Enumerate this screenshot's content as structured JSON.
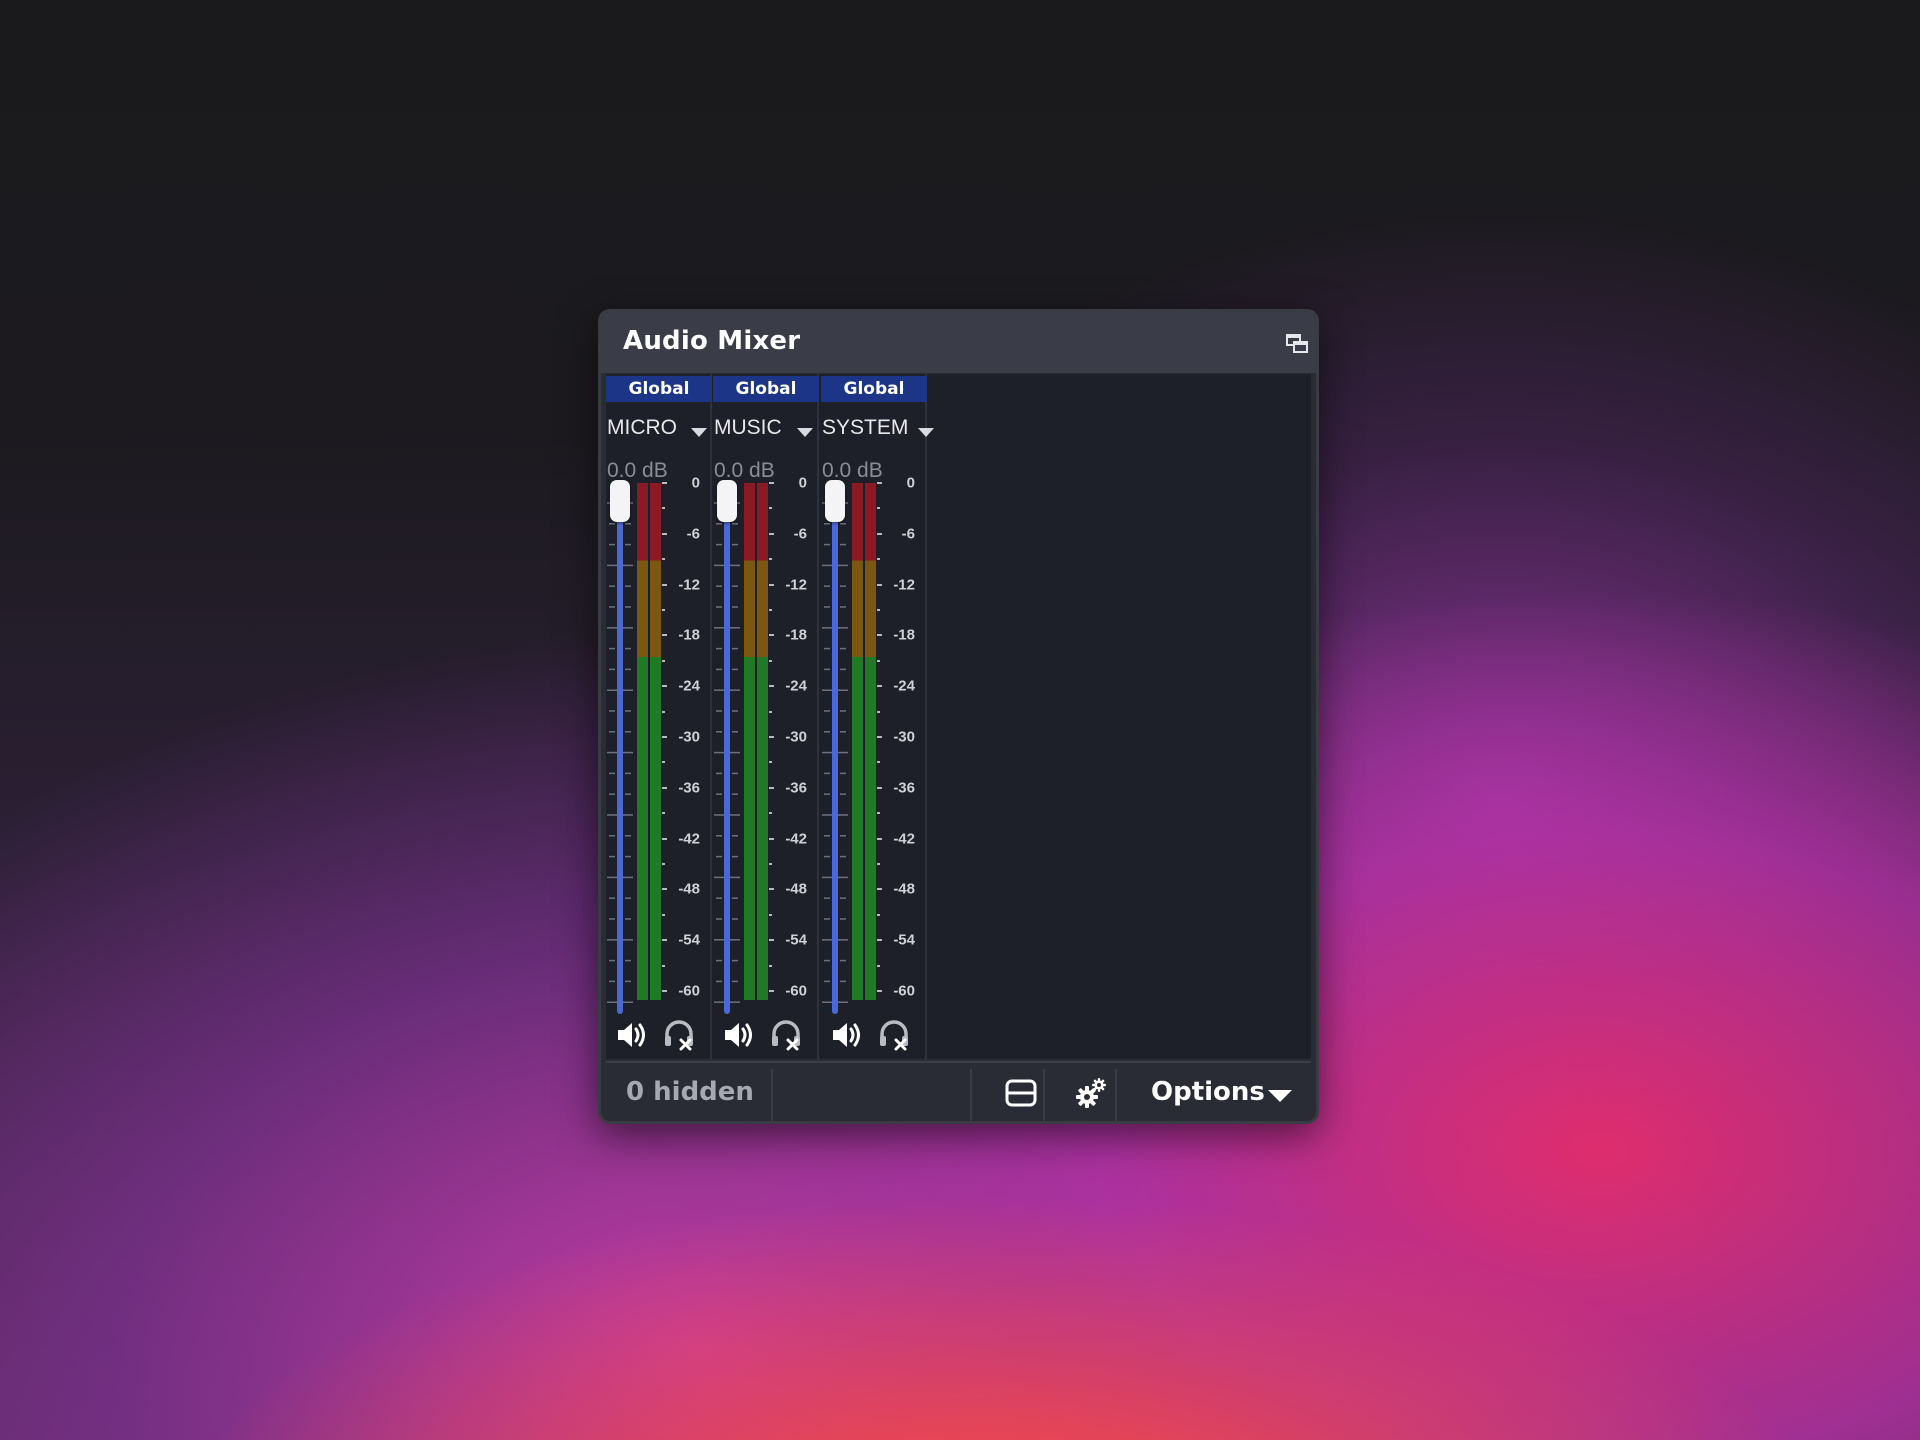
{
  "window": {
    "title": "Audio Mixer",
    "undock_icon": "undock-icon"
  },
  "channels": [
    {
      "scope": "Global",
      "name": "MICRO",
      "volume": "0.0 dB",
      "fader_level": 1.0,
      "mute_icon": "speaker-icon",
      "monitor_icon": "headphones-off-icon"
    },
    {
      "scope": "Global",
      "name": "MUSIC",
      "volume": "0.0 dB",
      "fader_level": 1.0,
      "mute_icon": "speaker-icon",
      "monitor_icon": "headphones-off-icon"
    },
    {
      "scope": "Global",
      "name": "SYSTEM",
      "volume": "0.0 dB",
      "fader_level": 1.0,
      "mute_icon": "speaker-icon",
      "monitor_icon": "headphones-off-icon"
    }
  ],
  "meter_scale": [
    "0",
    "-6",
    "-12",
    "-18",
    "-24",
    "-30",
    "-36",
    "-42",
    "-48",
    "-54",
    "-60"
  ],
  "meter_colors": {
    "red": "#8b1a25",
    "yellow": "#7b5711",
    "green": "#1e7a25",
    "fader": "#4a68d6",
    "scope_tab": "#1d3586"
  },
  "footer": {
    "hidden_count": "0 hidden",
    "layout_icon": "layout-toggle-icon",
    "settings_icon": "settings-gears-icon",
    "options_label": "Options"
  }
}
